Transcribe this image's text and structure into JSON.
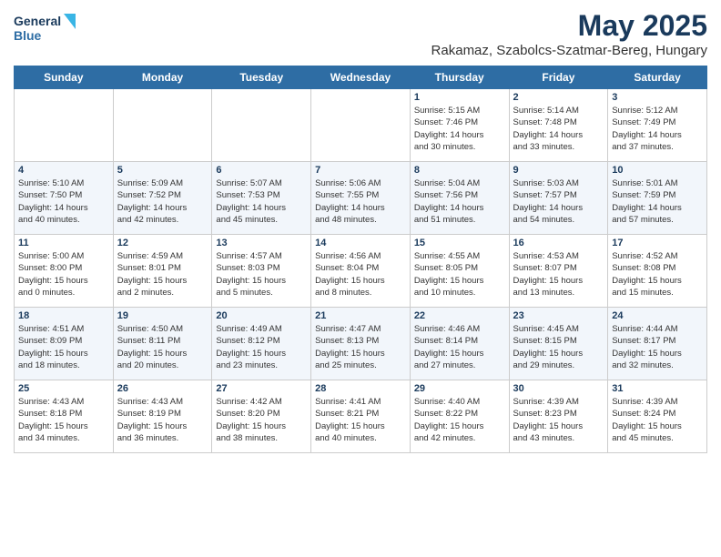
{
  "header": {
    "logo_line1": "General",
    "logo_line2": "Blue",
    "month_title": "May 2025",
    "location": "Rakamaz, Szabolcs-Szatmar-Bereg, Hungary"
  },
  "weekdays": [
    "Sunday",
    "Monday",
    "Tuesday",
    "Wednesday",
    "Thursday",
    "Friday",
    "Saturday"
  ],
  "weeks": [
    [
      {
        "day": "",
        "content": ""
      },
      {
        "day": "",
        "content": ""
      },
      {
        "day": "",
        "content": ""
      },
      {
        "day": "",
        "content": ""
      },
      {
        "day": "1",
        "content": "Sunrise: 5:15 AM\nSunset: 7:46 PM\nDaylight: 14 hours\nand 30 minutes."
      },
      {
        "day": "2",
        "content": "Sunrise: 5:14 AM\nSunset: 7:48 PM\nDaylight: 14 hours\nand 33 minutes."
      },
      {
        "day": "3",
        "content": "Sunrise: 5:12 AM\nSunset: 7:49 PM\nDaylight: 14 hours\nand 37 minutes."
      }
    ],
    [
      {
        "day": "4",
        "content": "Sunrise: 5:10 AM\nSunset: 7:50 PM\nDaylight: 14 hours\nand 40 minutes."
      },
      {
        "day": "5",
        "content": "Sunrise: 5:09 AM\nSunset: 7:52 PM\nDaylight: 14 hours\nand 42 minutes."
      },
      {
        "day": "6",
        "content": "Sunrise: 5:07 AM\nSunset: 7:53 PM\nDaylight: 14 hours\nand 45 minutes."
      },
      {
        "day": "7",
        "content": "Sunrise: 5:06 AM\nSunset: 7:55 PM\nDaylight: 14 hours\nand 48 minutes."
      },
      {
        "day": "8",
        "content": "Sunrise: 5:04 AM\nSunset: 7:56 PM\nDaylight: 14 hours\nand 51 minutes."
      },
      {
        "day": "9",
        "content": "Sunrise: 5:03 AM\nSunset: 7:57 PM\nDaylight: 14 hours\nand 54 minutes."
      },
      {
        "day": "10",
        "content": "Sunrise: 5:01 AM\nSunset: 7:59 PM\nDaylight: 14 hours\nand 57 minutes."
      }
    ],
    [
      {
        "day": "11",
        "content": "Sunrise: 5:00 AM\nSunset: 8:00 PM\nDaylight: 15 hours\nand 0 minutes."
      },
      {
        "day": "12",
        "content": "Sunrise: 4:59 AM\nSunset: 8:01 PM\nDaylight: 15 hours\nand 2 minutes."
      },
      {
        "day": "13",
        "content": "Sunrise: 4:57 AM\nSunset: 8:03 PM\nDaylight: 15 hours\nand 5 minutes."
      },
      {
        "day": "14",
        "content": "Sunrise: 4:56 AM\nSunset: 8:04 PM\nDaylight: 15 hours\nand 8 minutes."
      },
      {
        "day": "15",
        "content": "Sunrise: 4:55 AM\nSunset: 8:05 PM\nDaylight: 15 hours\nand 10 minutes."
      },
      {
        "day": "16",
        "content": "Sunrise: 4:53 AM\nSunset: 8:07 PM\nDaylight: 15 hours\nand 13 minutes."
      },
      {
        "day": "17",
        "content": "Sunrise: 4:52 AM\nSunset: 8:08 PM\nDaylight: 15 hours\nand 15 minutes."
      }
    ],
    [
      {
        "day": "18",
        "content": "Sunrise: 4:51 AM\nSunset: 8:09 PM\nDaylight: 15 hours\nand 18 minutes."
      },
      {
        "day": "19",
        "content": "Sunrise: 4:50 AM\nSunset: 8:11 PM\nDaylight: 15 hours\nand 20 minutes."
      },
      {
        "day": "20",
        "content": "Sunrise: 4:49 AM\nSunset: 8:12 PM\nDaylight: 15 hours\nand 23 minutes."
      },
      {
        "day": "21",
        "content": "Sunrise: 4:47 AM\nSunset: 8:13 PM\nDaylight: 15 hours\nand 25 minutes."
      },
      {
        "day": "22",
        "content": "Sunrise: 4:46 AM\nSunset: 8:14 PM\nDaylight: 15 hours\nand 27 minutes."
      },
      {
        "day": "23",
        "content": "Sunrise: 4:45 AM\nSunset: 8:15 PM\nDaylight: 15 hours\nand 29 minutes."
      },
      {
        "day": "24",
        "content": "Sunrise: 4:44 AM\nSunset: 8:17 PM\nDaylight: 15 hours\nand 32 minutes."
      }
    ],
    [
      {
        "day": "25",
        "content": "Sunrise: 4:43 AM\nSunset: 8:18 PM\nDaylight: 15 hours\nand 34 minutes."
      },
      {
        "day": "26",
        "content": "Sunrise: 4:43 AM\nSunset: 8:19 PM\nDaylight: 15 hours\nand 36 minutes."
      },
      {
        "day": "27",
        "content": "Sunrise: 4:42 AM\nSunset: 8:20 PM\nDaylight: 15 hours\nand 38 minutes."
      },
      {
        "day": "28",
        "content": "Sunrise: 4:41 AM\nSunset: 8:21 PM\nDaylight: 15 hours\nand 40 minutes."
      },
      {
        "day": "29",
        "content": "Sunrise: 4:40 AM\nSunset: 8:22 PM\nDaylight: 15 hours\nand 42 minutes."
      },
      {
        "day": "30",
        "content": "Sunrise: 4:39 AM\nSunset: 8:23 PM\nDaylight: 15 hours\nand 43 minutes."
      },
      {
        "day": "31",
        "content": "Sunrise: 4:39 AM\nSunset: 8:24 PM\nDaylight: 15 hours\nand 45 minutes."
      }
    ]
  ]
}
